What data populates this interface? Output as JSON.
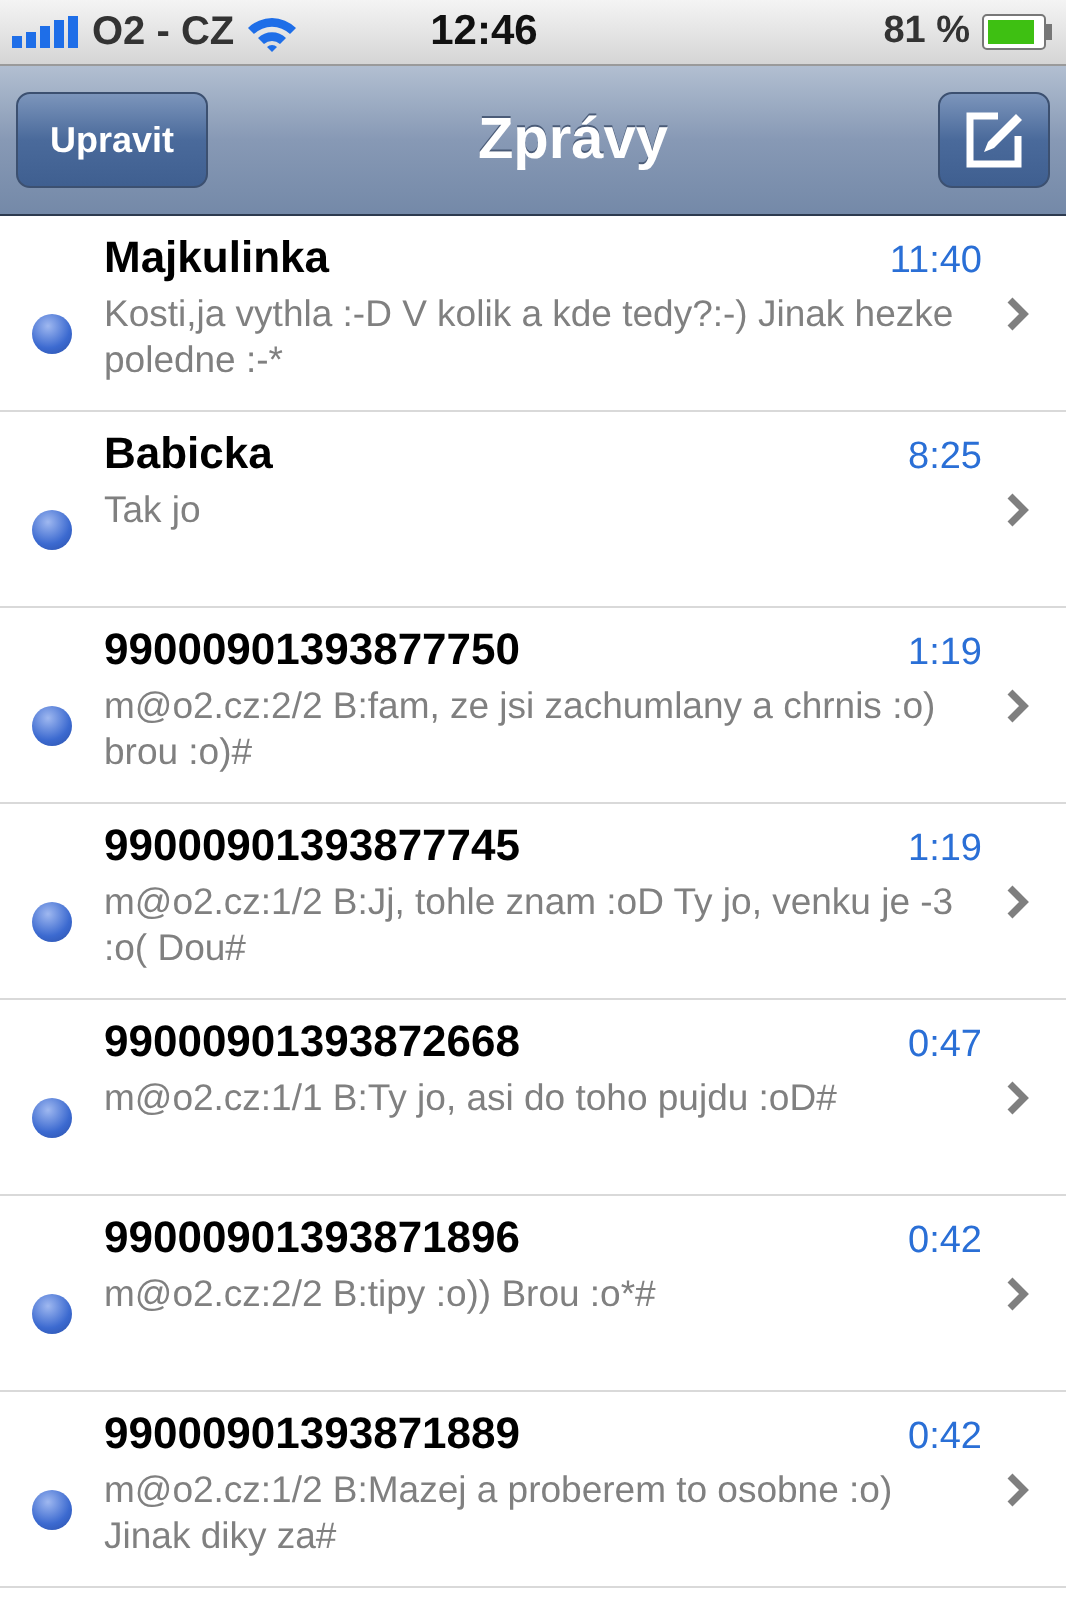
{
  "status_bar": {
    "carrier": "O2 - CZ",
    "time": "12:46",
    "battery": "81 %"
  },
  "nav_bar": {
    "edit_button": "Upravit",
    "title": "Zprávy"
  },
  "messages": [
    {
      "sender": "Majkulinka",
      "time": "11:40",
      "preview": "Kosti,ja vythla :-D V kolik a kde tedy?:-) Jinak hezke poledne :-*",
      "unread": true
    },
    {
      "sender": "Babicka",
      "time": "8:25",
      "preview": "Tak jo",
      "unread": true
    },
    {
      "sender": "99000901393877750",
      "time": "1:19",
      "preview": "m@o2.cz:2/2 B:fam, ze jsi zachumlany a chrnis :o) brou :o)#",
      "unread": true
    },
    {
      "sender": "99000901393877745",
      "time": "1:19",
      "preview": "m@o2.cz:1/2 B:Jj, tohle znam :oD Ty jo, venku je -3 :o( Dou#",
      "unread": true
    },
    {
      "sender": "99000901393872668",
      "time": "0:47",
      "preview": "m@o2.cz:1/1 B:Ty jo, asi do toho pujdu :oD#",
      "unread": true
    },
    {
      "sender": "99000901393871896",
      "time": "0:42",
      "preview": "m@o2.cz:2/2 B:tipy :o)) Brou :o*#",
      "unread": true
    },
    {
      "sender": "99000901393871889",
      "time": "0:42",
      "preview": "m@o2.cz:1/2 B:Mazej a proberem to osobne :o) Jinak diky za#",
      "unread": true
    }
  ]
}
